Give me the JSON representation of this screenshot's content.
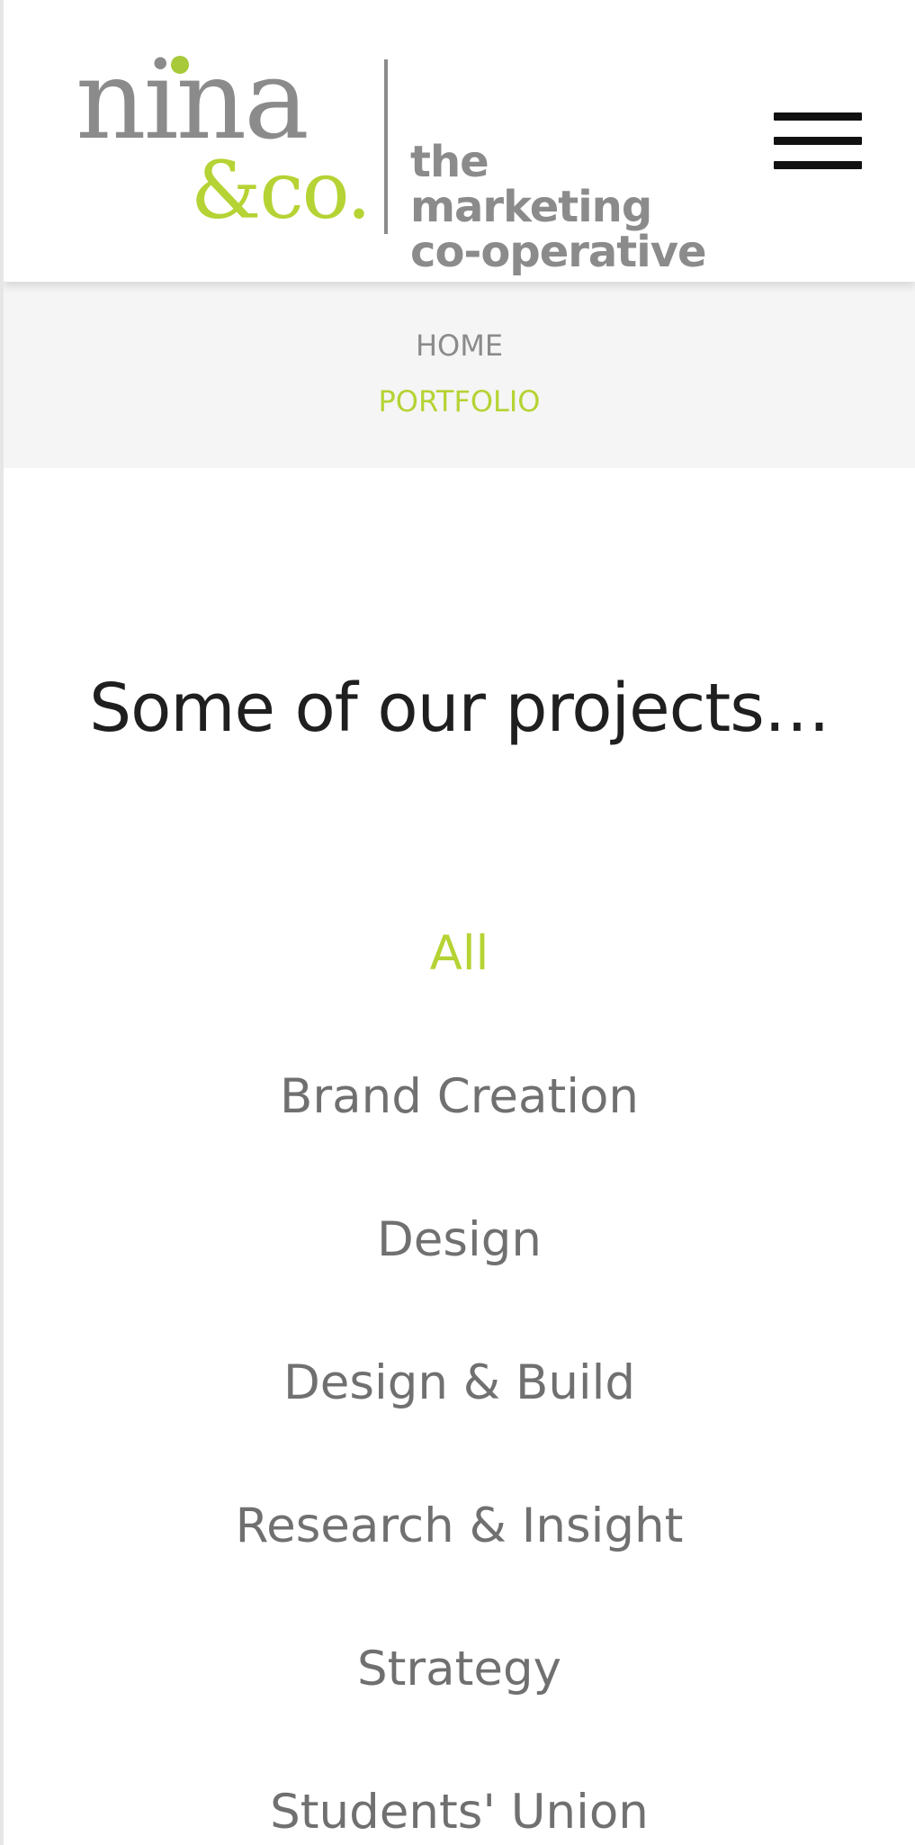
{
  "header": {
    "logo": {
      "name": "nina",
      "ampersand_co": "&co.",
      "tagline_line1": "the marketing",
      "tagline_line2": "co-operative"
    },
    "menu_icon": "hamburger-menu-icon"
  },
  "breadcrumb": {
    "home": "HOME",
    "current": "PORTFOLIO"
  },
  "main": {
    "title": "Some of our projects…",
    "filters": [
      {
        "label": "All",
        "active": true
      },
      {
        "label": "Brand Creation",
        "active": false
      },
      {
        "label": "Design",
        "active": false
      },
      {
        "label": "Design & Build",
        "active": false
      },
      {
        "label": "Research & Insight",
        "active": false
      },
      {
        "label": "Strategy",
        "active": false
      },
      {
        "label": "Students' Union",
        "active": false
      }
    ]
  },
  "colors": {
    "accent": "#b5d334",
    "logo_grey": "#8b8b8b",
    "text_dark": "#1f1f1f",
    "filter_grey": "#707070",
    "breadcrumb_bg": "#f5f5f5"
  }
}
